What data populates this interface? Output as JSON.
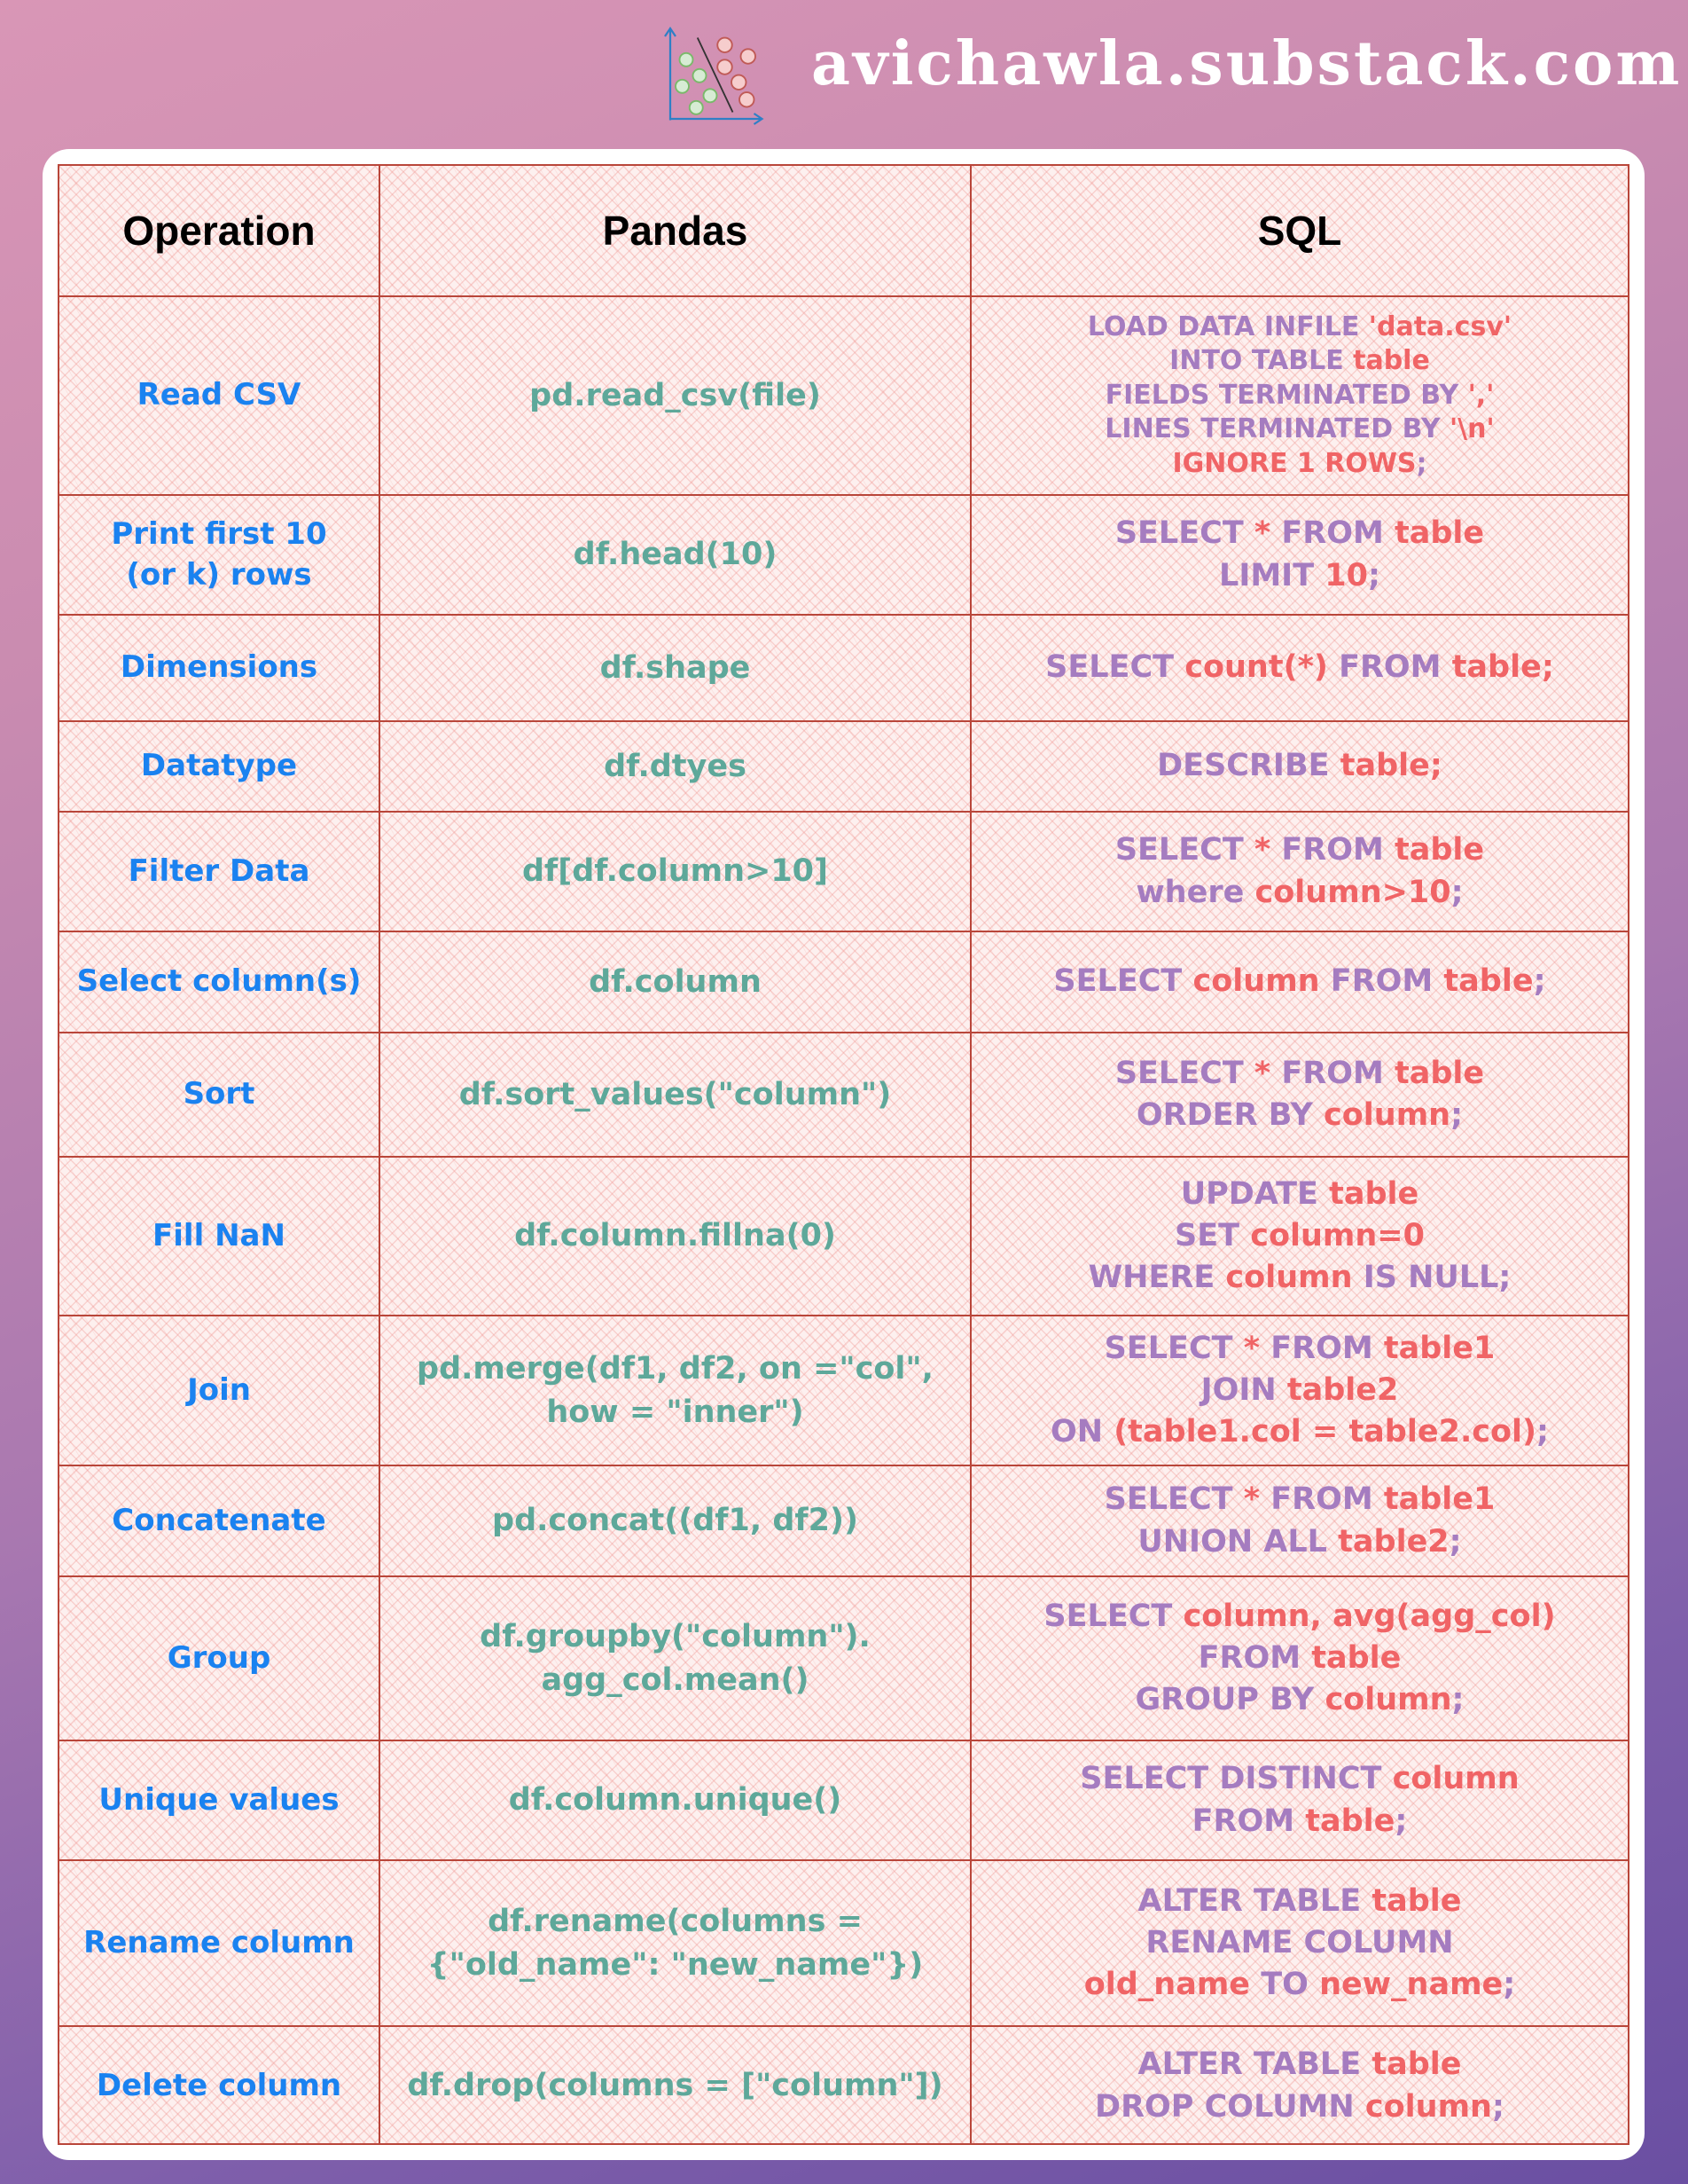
{
  "brand": {
    "site": "avichawla.substack.com",
    "logo_icon": "classification-scatter-icon"
  },
  "colors": {
    "operation": "#1a82f0",
    "pandas": "#5ea89a",
    "sql_keyword": "#a57cc0",
    "sql_identifier": "#f06466",
    "grid": "#b9463a"
  },
  "table": {
    "headers": [
      "Operation",
      "Pandas",
      "SQL"
    ],
    "rows": [
      {
        "operation": [
          "Read CSV"
        ],
        "pandas": [
          "pd.read_csv(file)"
        ],
        "sql_small": true,
        "sql": [
          [
            [
              "kw",
              "LOAD DATA INFILE "
            ],
            [
              "id",
              "'data.csv'"
            ]
          ],
          [
            [
              "kw",
              "INTO TABLE "
            ],
            [
              "id",
              "table"
            ]
          ],
          [
            [
              "kw",
              "FIELDS TERMINATED BY "
            ],
            [
              "id",
              "','"
            ]
          ],
          [
            [
              "kw",
              "LINES TERMINATED BY "
            ],
            [
              "id",
              "'\\n'"
            ]
          ],
          [
            [
              "id",
              "IGNORE 1 ROWS"
            ],
            [
              "kw",
              ";"
            ]
          ]
        ]
      },
      {
        "operation": [
          "Print first 10",
          "(or k) rows"
        ],
        "pandas": [
          "df.head(10)"
        ],
        "sql": [
          [
            [
              "kw",
              "SELECT "
            ],
            [
              "id",
              "* "
            ],
            [
              "kw",
              "FROM "
            ],
            [
              "id",
              "table"
            ]
          ],
          [
            [
              "kw",
              "LIMIT "
            ],
            [
              "id",
              "10"
            ],
            [
              "kw",
              ";"
            ]
          ]
        ]
      },
      {
        "operation": [
          "Dimensions"
        ],
        "pandas": [
          "df.shape"
        ],
        "sql": [
          [
            [
              "kw",
              "SELECT "
            ],
            [
              "id",
              "count(*) "
            ],
            [
              "kw",
              "FROM "
            ],
            [
              "id",
              "table;"
            ]
          ]
        ]
      },
      {
        "operation": [
          "Datatype"
        ],
        "pandas": [
          "df.dtyes"
        ],
        "sql": [
          [
            [
              "kw",
              "DESCRIBE "
            ],
            [
              "id",
              "table;"
            ]
          ]
        ]
      },
      {
        "operation": [
          "Filter Data"
        ],
        "pandas": [
          "df[df.column>10]"
        ],
        "sql": [
          [
            [
              "kw",
              "SELECT "
            ],
            [
              "id",
              "* "
            ],
            [
              "kw",
              "FROM "
            ],
            [
              "id",
              "table"
            ]
          ],
          [
            [
              "kw",
              "where "
            ],
            [
              "id",
              "column>10"
            ],
            [
              "kw",
              ";"
            ]
          ]
        ]
      },
      {
        "operation": [
          "Select column(s)"
        ],
        "pandas": [
          "df.column"
        ],
        "sql": [
          [
            [
              "kw",
              "SELECT "
            ],
            [
              "id",
              "column "
            ],
            [
              "kw",
              "FROM "
            ],
            [
              "id",
              "table"
            ],
            [
              "kw",
              ";"
            ]
          ]
        ]
      },
      {
        "operation": [
          "Sort"
        ],
        "pandas": [
          "df.sort_values(\"column\")"
        ],
        "sql": [
          [
            [
              "kw",
              "SELECT "
            ],
            [
              "id",
              "* "
            ],
            [
              "kw",
              "FROM "
            ],
            [
              "id",
              "table"
            ]
          ],
          [
            [
              "kw",
              "ORDER BY "
            ],
            [
              "id",
              "column"
            ],
            [
              "kw",
              ";"
            ]
          ]
        ]
      },
      {
        "operation": [
          "Fill NaN"
        ],
        "pandas": [
          "df.column.fillna(0)"
        ],
        "sql": [
          [
            [
              "kw",
              "UPDATE "
            ],
            [
              "id",
              "table"
            ]
          ],
          [
            [
              "kw",
              "SET "
            ],
            [
              "id",
              "column=0"
            ]
          ],
          [
            [
              "kw",
              "WHERE "
            ],
            [
              "id",
              "column "
            ],
            [
              "kw",
              "IS NULL;"
            ]
          ]
        ]
      },
      {
        "operation": [
          "Join"
        ],
        "pandas": [
          "pd.merge(df1, df2, on =\"col\",",
          "how = \"inner\")"
        ],
        "sql": [
          [
            [
              "kw",
              "SELECT "
            ],
            [
              "id",
              "* "
            ],
            [
              "kw",
              "FROM "
            ],
            [
              "id",
              "table1"
            ]
          ],
          [
            [
              "kw",
              "JOIN "
            ],
            [
              "id",
              "table2"
            ]
          ],
          [
            [
              "kw",
              "ON "
            ],
            [
              "id",
              "(table1.col = table2.col)"
            ],
            [
              "kw",
              ";"
            ]
          ]
        ]
      },
      {
        "operation": [
          "Concatenate"
        ],
        "pandas": [
          "pd.concat((df1, df2))"
        ],
        "sql": [
          [
            [
              "kw",
              "SELECT "
            ],
            [
              "id",
              "* "
            ],
            [
              "kw",
              "FROM "
            ],
            [
              "id",
              "table1"
            ]
          ],
          [
            [
              "kw",
              "UNION ALL "
            ],
            [
              "id",
              "table2"
            ],
            [
              "kw",
              ";"
            ]
          ]
        ]
      },
      {
        "operation": [
          "Group"
        ],
        "pandas": [
          "df.groupby(\"column\").",
          "agg_col.mean()"
        ],
        "sql": [
          [
            [
              "kw",
              "SELECT "
            ],
            [
              "id",
              "column, avg(agg_col)"
            ]
          ],
          [
            [
              "kw",
              "FROM "
            ],
            [
              "id",
              "table"
            ]
          ],
          [
            [
              "kw",
              "GROUP BY "
            ],
            [
              "id",
              "column"
            ],
            [
              "kw",
              ";"
            ]
          ]
        ]
      },
      {
        "operation": [
          "Unique values"
        ],
        "pandas": [
          "df.column.unique()"
        ],
        "sql": [
          [
            [
              "kw",
              "SELECT DISTINCT "
            ],
            [
              "id",
              "column"
            ]
          ],
          [
            [
              "kw",
              "FROM "
            ],
            [
              "id",
              "table"
            ],
            [
              "kw",
              ";"
            ]
          ]
        ]
      },
      {
        "operation": [
          "Rename column"
        ],
        "pandas": [
          "df.rename(columns =",
          "{\"old_name\": \"new_name\"})"
        ],
        "sql": [
          [
            [
              "kw",
              "ALTER TABLE "
            ],
            [
              "id",
              "table"
            ]
          ],
          [
            [
              "kw",
              "RENAME COLUMN"
            ]
          ],
          [
            [
              "id",
              "old_name "
            ],
            [
              "kw",
              "TO "
            ],
            [
              "id",
              "new_name"
            ],
            [
              "kw",
              ";"
            ]
          ]
        ]
      },
      {
        "operation": [
          "Delete column"
        ],
        "pandas": [
          "df.drop(columns = [\"column\"])"
        ],
        "sql": [
          [
            [
              "kw",
              "ALTER TABLE "
            ],
            [
              "id",
              "table"
            ]
          ],
          [
            [
              "kw",
              "DROP COLUMN "
            ],
            [
              "id",
              "column"
            ],
            [
              "kw",
              ";"
            ]
          ]
        ]
      }
    ]
  }
}
